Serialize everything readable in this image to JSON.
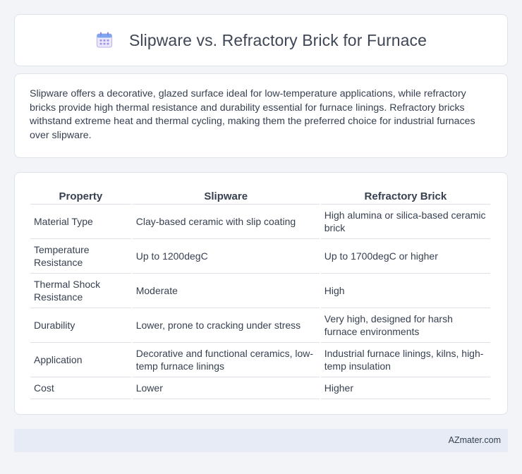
{
  "header": {
    "title": "Slipware vs. Refractory Brick for Furnace",
    "icon": "calendar-icon"
  },
  "intro": {
    "text": "Slipware offers a decorative, glazed surface ideal for low-temperature applications, while refractory bricks provide high thermal resistance and durability essential for furnace linings. Refractory bricks withstand extreme heat and thermal cycling, making them the preferred choice for industrial furnaces over slipware."
  },
  "table": {
    "headers": [
      "Property",
      "Slipware",
      "Refractory Brick"
    ],
    "rows": [
      [
        "Material Type",
        "Clay-based ceramic with slip coating",
        "High alumina or silica-based ceramic brick"
      ],
      [
        "Temperature Resistance",
        "Up to 1200degC",
        "Up to 1700degC or higher"
      ],
      [
        "Thermal Shock Resistance",
        "Moderate",
        "High"
      ],
      [
        "Durability",
        "Lower, prone to cracking under stress",
        "Very high, designed for harsh furnace environments"
      ],
      [
        "Application",
        "Decorative and functional ceramics, low-temp furnace linings",
        "Industrial furnace linings, kilns, high-temp insulation"
      ],
      [
        "Cost",
        "Lower",
        "Higher"
      ]
    ]
  },
  "footer": {
    "brand": "AZmater.com"
  }
}
